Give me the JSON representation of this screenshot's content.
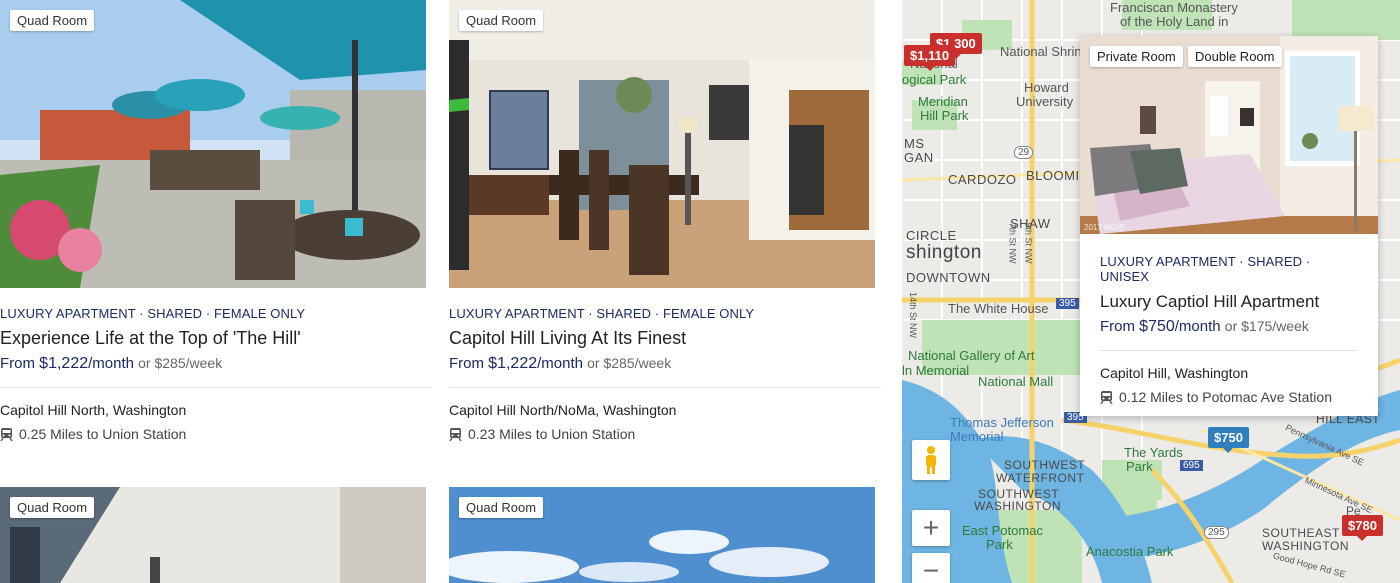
{
  "listings": [
    {
      "badge": "Quad Room",
      "meta": "LUXURY APARTMENT · SHARED · FEMALE ONLY",
      "title": "Experience Life at the Top of 'The Hill'",
      "price_from": "From",
      "price_amount": "$1,222",
      "price_unit": "/month",
      "price_week": "or $285/week",
      "location": "Capitol Hill North, Washington",
      "station": "0.25 Miles to Union Station"
    },
    {
      "badge": "Quad Room",
      "meta": "LUXURY APARTMENT · SHARED · FEMALE ONLY",
      "title": "Capitol Hill Living At Its Finest",
      "price_from": "From",
      "price_amount": "$1,222",
      "price_unit": "/month",
      "price_week": "or $285/week",
      "location": "Capitol Hill North/NoMa, Washington",
      "station": "0.23 Miles to Union Station"
    },
    {
      "badge": "Quad Room"
    },
    {
      "badge": "Quad Room"
    }
  ],
  "popup": {
    "tags": [
      "Private Room",
      "Double Room"
    ],
    "watermark": "2017 MGIS",
    "meta": "LUXURY APARTMENT · SHARED · UNISEX",
    "title": "Luxury Captiol Hill Apartment",
    "price_from": "From",
    "price_amount": "$750",
    "price_unit": "/month",
    "price_week": "or $175/week",
    "location": "Capitol Hill, Washington",
    "station": "0.12 Miles to Potomac Ave Station"
  },
  "map": {
    "pins": [
      "$1,300",
      "$1,110",
      "$750",
      "$780"
    ],
    "labels": {
      "franciscan": "Franciscan Monastery",
      "holy_land": "of the Holy Land in",
      "national_shrine": "National Shrin",
      "national": "National",
      "logical_park": "ogical Park",
      "howard": "Howard",
      "university": "University",
      "meridian": "Meridian",
      "hill_park": "Hill Park",
      "ms": "MS",
      "gan": "GAN",
      "cardozo": "CARDOZO",
      "bloomi": "BLOOMI",
      "shaw": "SHAW",
      "circle": "CIRCLE",
      "washington_big": "shington",
      "downtown": "DOWNTOWN",
      "white_house": "The White House",
      "gallery": "National Gallery of Art",
      "memorial": "ln Memorial",
      "national_mall": "National Mall",
      "jefferson": "Thomas Jefferson",
      "jefferson2": "Memorial",
      "yards": "The Yards",
      "yards_park": "Park",
      "southwest": "SOUTHWEST",
      "waterfront": "WATERFRONT",
      "southwest2": "SOUTHWEST",
      "washington_sw": "WASHINGTON",
      "east_potomac": "East Potomac",
      "east_potomac2": "Park",
      "anacostia": "Anacostia Park",
      "southeast": "SOUTHEAST",
      "washington_se": "WASHINGTON",
      "hill_east": "HILL EAST",
      "st9": "9th St NW",
      "st7": "7th St NW",
      "st14": "14th St NW",
      "r29": "29",
      "r395": "395",
      "r395b": "395",
      "r695": "695",
      "r295": "295",
      "pa_ave": "Pennsylvania Ave SE",
      "mn_ave": "Minnesota Ave SE",
      "good_hope": "Good Hope Rd SE",
      "pe": "Pe"
    },
    "zoom_in": "+",
    "zoom_out": "−"
  },
  "colors": {
    "accent_navy": "#1c2a66",
    "pin_red": "#c9302c",
    "pin_blue": "#2f7fbf",
    "water": "#6fb5e3",
    "park": "#bfe2b6",
    "road_yellow": "#f5d36a"
  }
}
